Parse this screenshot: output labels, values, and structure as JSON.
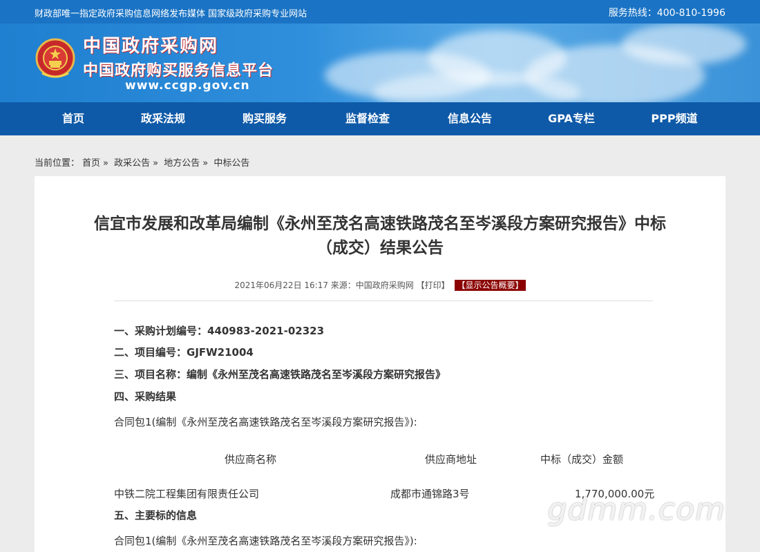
{
  "topbar": {
    "tagline": "财政部唯一指定政府采购信息网络发布媒体  国家级政府采购专业网站",
    "hotline": "服务热线：400-810-1996"
  },
  "logo": {
    "name": "中国政府采购网",
    "subname": "中国政府购买服务信息平台",
    "url": "www.ccgp.gov.cn"
  },
  "nav": [
    "首页",
    "政采法规",
    "购买服务",
    "监督检查",
    "信息公告",
    "GPA专栏",
    "PPP频道"
  ],
  "breadcrumb": {
    "prefix": "当前位置：",
    "items": [
      "首页",
      "政采公告",
      "地方公告",
      "中标公告"
    ],
    "separator": "»"
  },
  "article": {
    "title_line1": "信宜市发展和改革局编制《永州至茂名高速铁路茂名至岑溪段方案研究报告》中标",
    "title_line2": "（成交）结果公告",
    "date": "2021年06月22日 16:17",
    "source": "来源：中国政府采购网",
    "print": "【打印】",
    "summary": "【显示公告概要】",
    "s1": "一、采购计划编号：440983-2021-02323",
    "s2": "二、项目编号：GJFW21004",
    "s3": "三、项目名称：编制《永州至茂名高速铁路茂名至岑溪段方案研究报告》",
    "s4": "四、采购结果",
    "pkg": "合同包1(编制《永州至茂名高速铁路茂名至岑溪段方案研究报告》):",
    "table": {
      "headers": [
        "供应商名称",
        "供应商地址",
        "中标（成交）金额"
      ],
      "row": [
        "中铁二院工程集团有限责任公司",
        "成都市通锦路3号",
        "1,770,000.00元"
      ]
    },
    "s5": "五、主要标的信息",
    "pkg2": "合同包1(编制《永州至茂名高速铁路茂名至岑溪段方案研究报告》):"
  },
  "watermark": "gdmm.com",
  "colors": {
    "topbar": "#1a73c4",
    "nav": "#0f5aa8",
    "summary_btn": "#8b0000"
  }
}
